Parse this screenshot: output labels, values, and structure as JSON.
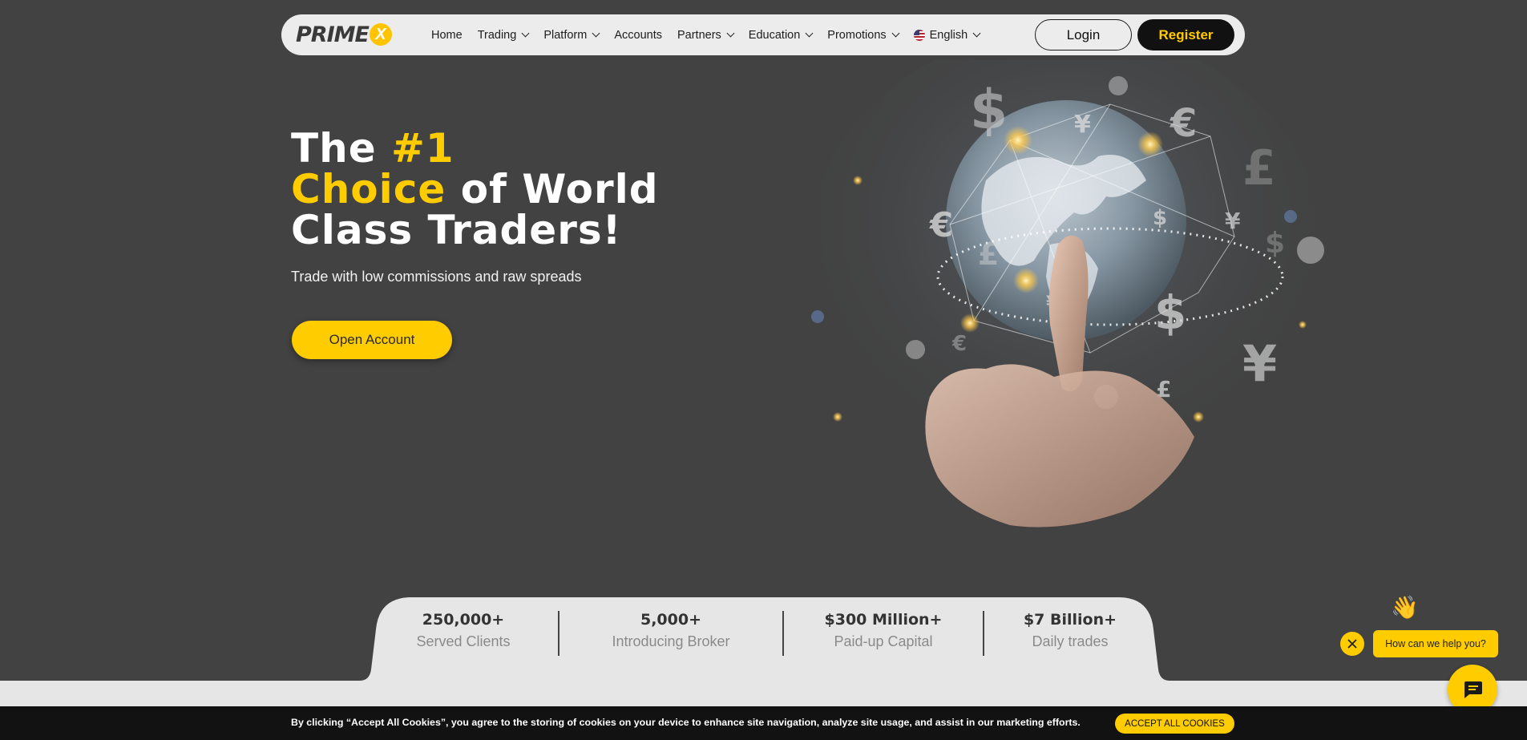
{
  "brand": {
    "logo_text": "PRIME",
    "logo_mark": "X"
  },
  "nav": {
    "items": [
      {
        "label": "Home",
        "dropdown": false
      },
      {
        "label": "Trading",
        "dropdown": true
      },
      {
        "label": "Platform",
        "dropdown": true
      },
      {
        "label": "Accounts",
        "dropdown": false
      },
      {
        "label": "Partners",
        "dropdown": true
      },
      {
        "label": "Education",
        "dropdown": true
      },
      {
        "label": "Promotions",
        "dropdown": true
      }
    ],
    "language": "English",
    "language_icon": "us-flag-icon",
    "login_label": "Login",
    "register_label": "Register"
  },
  "hero": {
    "title_1": "The ",
    "title_highlight_1": "#1",
    "title_highlight_2": "Choice",
    "title_2": " of World",
    "title_3": "Class Traders!",
    "subtitle": "Trade with low commissions and raw spreads",
    "cta_label": "Open Account",
    "image_icons": [
      "globe-icon",
      "hand-icon",
      "dollar-icon",
      "euro-icon",
      "pound-icon",
      "yen-icon"
    ]
  },
  "stats": [
    {
      "value": "250,000+",
      "label": "Served Clients"
    },
    {
      "value": "5,000+",
      "label": "Introducing Broker"
    },
    {
      "value": "$300 Million+",
      "label": "Paid-up Capital"
    },
    {
      "value": "$7 Billion+",
      "label": "Daily trades"
    }
  ],
  "cookie": {
    "text": "By clicking “Accept All Cookies”, you agree to the storing of cookies on your device to enhance site navigation, analyze site usage, and assist in our marketing efforts.",
    "accept_label": "ACCEPT ALL COOKIES"
  },
  "chat": {
    "prompt": "How can we help you?",
    "wave_emoji": "👋"
  },
  "colors": {
    "accent": "#ffcc00",
    "background": "#424242",
    "nav_bg": "#ececec",
    "dark": "#111111"
  }
}
